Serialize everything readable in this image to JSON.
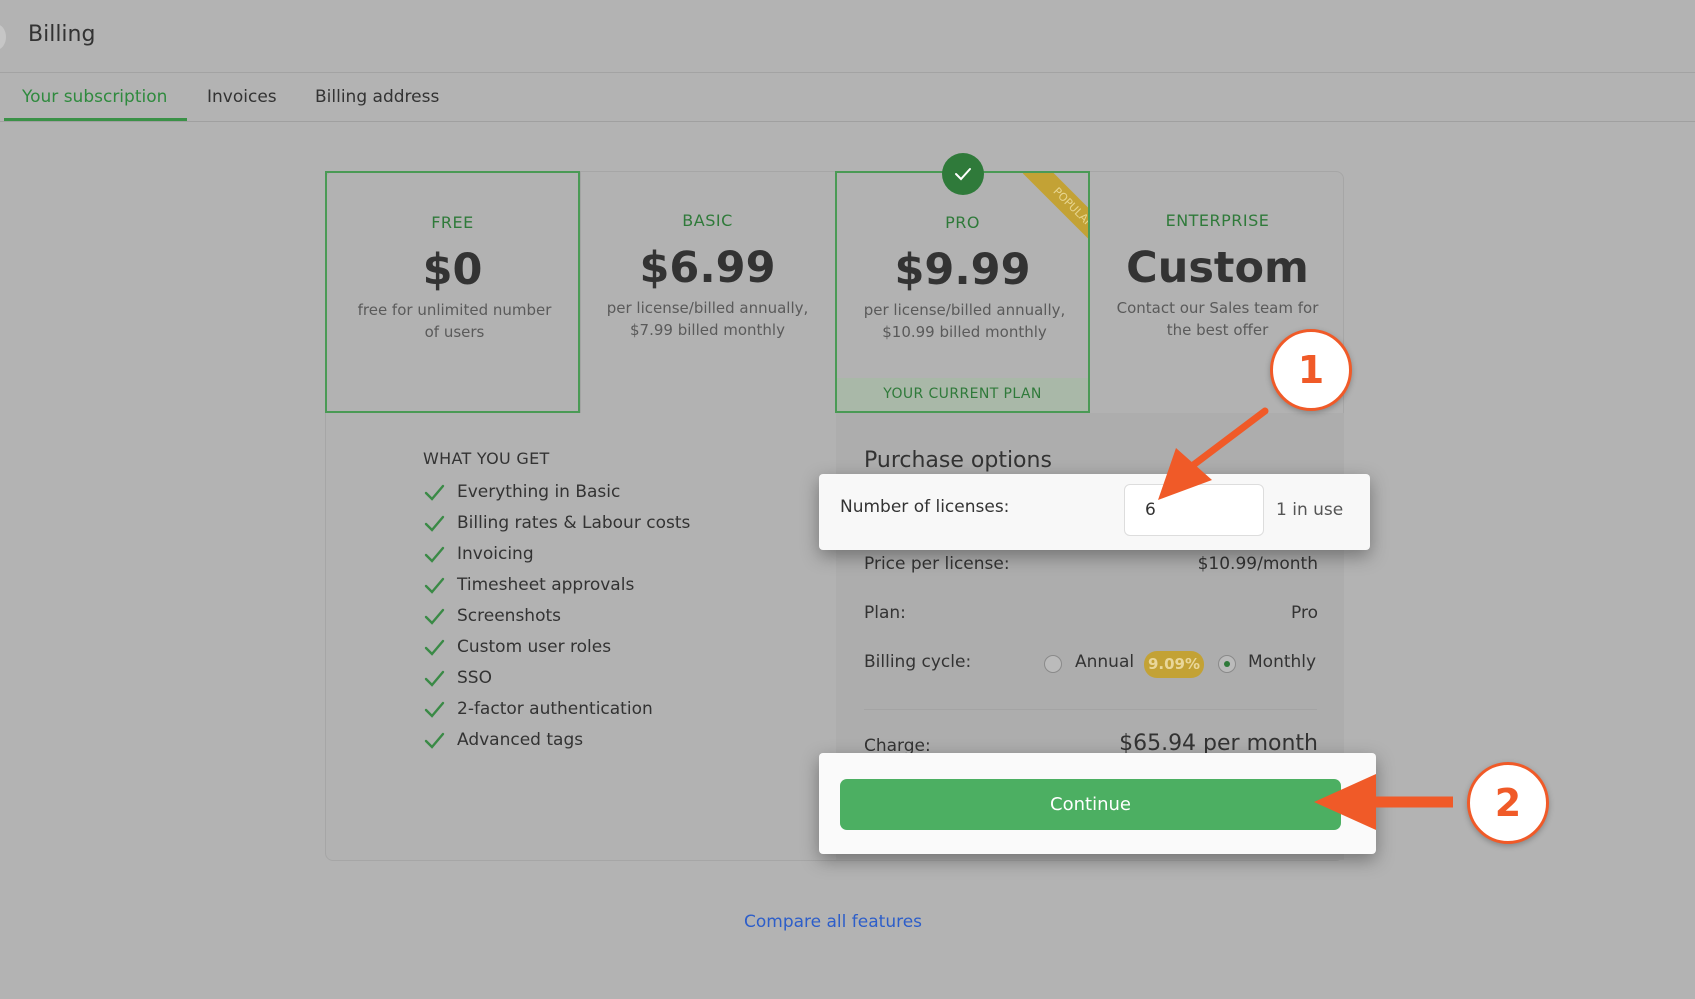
{
  "header": {
    "title": "Billing"
  },
  "tabs": [
    {
      "label": "Your subscription",
      "active": true
    },
    {
      "label": "Invoices",
      "active": false
    },
    {
      "label": "Billing address",
      "active": false
    }
  ],
  "plans": [
    {
      "name": "FREE",
      "price": "$0",
      "description": "free for unlimited number of users"
    },
    {
      "name": "BASIC",
      "price": "$6.99",
      "description": "per license/billed annually, $7.99 billed monthly"
    },
    {
      "name": "PRO",
      "price": "$9.99",
      "description": "per license/billed annually, $10.99 billed monthly",
      "ribbon": "POPULAR",
      "current_label": "YOUR CURRENT PLAN"
    },
    {
      "name": "ENTERPRISE",
      "price": "Custom",
      "description": "Contact our Sales team for the best offer"
    }
  ],
  "features": {
    "title": "WHAT YOU GET",
    "items": [
      "Everything in Basic",
      "Billing rates & Labour costs",
      "Invoicing",
      "Timesheet approvals",
      "Screenshots",
      "Custom user roles",
      "SSO",
      "2-factor authentication",
      "Advanced tags"
    ]
  },
  "purchase": {
    "title": "Purchase options",
    "licenses_label": "Number of licenses:",
    "licenses_value": "6",
    "in_use": "1 in use",
    "price_label": "Price per license:",
    "price_value": "$10.99/month",
    "plan_label": "Plan:",
    "plan_value": "Pro",
    "cycle_label": "Billing cycle:",
    "annual_label": "Annual",
    "annual_badge": "9.09%",
    "monthly_label": "Monthly",
    "selected_cycle": "Monthly",
    "charge_label": "Charge:",
    "charge_value": "$65.94 per month",
    "continue_label": "Continue"
  },
  "compare_link": "Compare all features",
  "annotations": {
    "callout_1": "1",
    "callout_2": "2"
  },
  "colors": {
    "accent_green": "#4caf62",
    "brand_green": "#2f7a3a",
    "callout_orange": "#f05a28",
    "badge_gold": "#c3a235"
  }
}
